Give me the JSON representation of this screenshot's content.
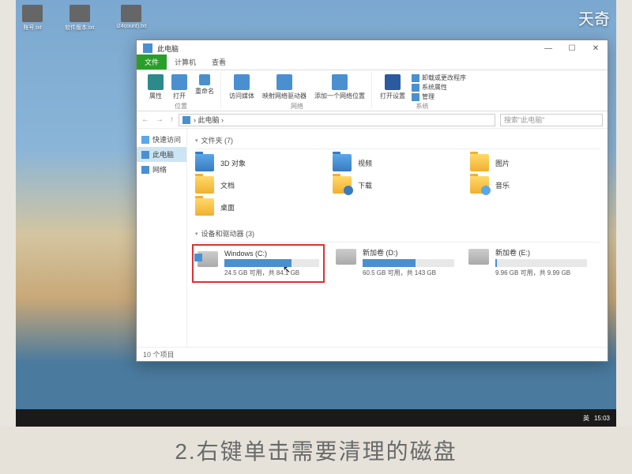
{
  "watermark": "天奇",
  "desktop": {
    "icons": [
      "账号.txt",
      "软件版本.txt",
      "i24count).txt"
    ]
  },
  "taskbar": {
    "time": "15:03",
    "lang": "英"
  },
  "window": {
    "title": "此电脑",
    "tabs": [
      "文件",
      "计算机",
      "查看"
    ],
    "ribbon": {
      "g1": {
        "items": [
          "属性",
          "打开",
          "重命名"
        ],
        "label": "位置"
      },
      "g2": {
        "items": [
          "访问媒体",
          "映射网络驱动器",
          "添加一个网络位置"
        ],
        "label": "网络"
      },
      "g3": {
        "open": "打开设置",
        "links": [
          "卸载或更改程序",
          "系统属性",
          "管理"
        ],
        "label": "系统"
      }
    },
    "breadcrumb": "› 此电脑 ›",
    "search_ph": "搜索\"此电脑\"",
    "nav": {
      "quick": "快速访问",
      "thispc": "此电脑",
      "network": "网络"
    },
    "folders_section": "文件夹 (7)",
    "folders": [
      "3D 对象",
      "视频",
      "图片",
      "文档",
      "下载",
      "音乐",
      "桌面"
    ],
    "drives_section": "设备和驱动器 (3)",
    "drives": [
      {
        "name": "Windows (C:)",
        "free": "24.5 GB 可用，共 84.1 GB",
        "pct": 71
      },
      {
        "name": "新加卷 (D:)",
        "free": "60.5 GB 可用，共 143 GB",
        "pct": 58
      },
      {
        "name": "新加卷 (E:)",
        "free": "9.96 GB 可用，共 9.99 GB",
        "pct": 2
      }
    ],
    "status": "10 个项目"
  },
  "caption": "2.右键单击需要清理的磁盘"
}
